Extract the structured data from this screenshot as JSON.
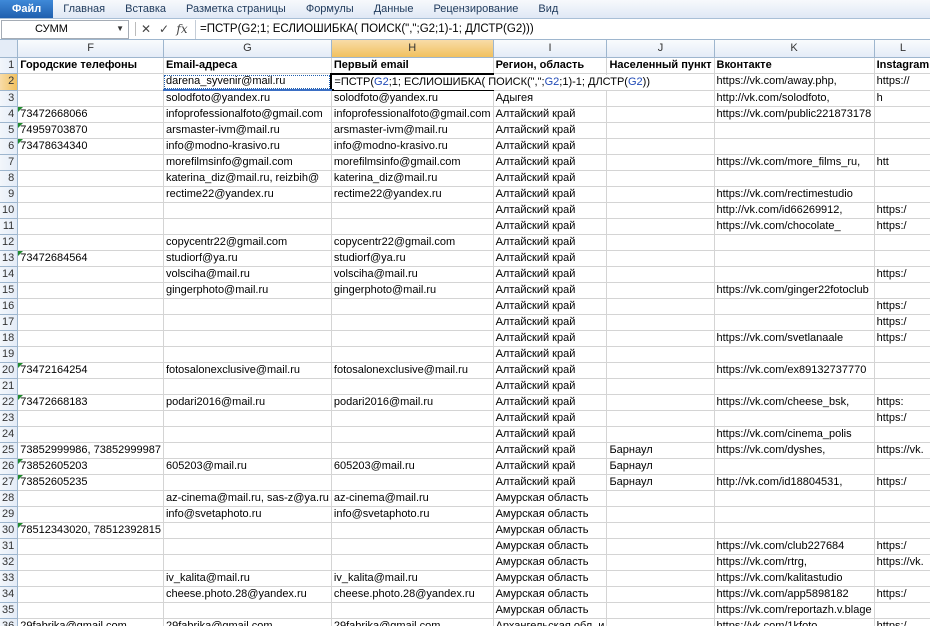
{
  "ribbon": {
    "tabs": [
      "Файл",
      "Главная",
      "Вставка",
      "Разметка страницы",
      "Формулы",
      "Данные",
      "Рецензирование",
      "Вид"
    ],
    "active_index": 0
  },
  "formula_bar": {
    "name_box": "СУММ",
    "cancel_glyph": "✕",
    "enter_glyph": "✓",
    "fx_label": "fx",
    "formula": "=ПСТР(G2;1; ЕСЛИОШИБКА( ПОИСК(\",\";G2;1)-1; ДЛСТР(G2)))"
  },
  "columns": [
    "F",
    "G",
    "H",
    "I",
    "J",
    "K",
    "L"
  ],
  "selected_column": "H",
  "active_cell_formula": {
    "p1": "=ПСТР(",
    "ref1": "G2",
    "p2": ";1; ЕСЛИОШИБКА( ПОИСК(\",\";",
    "ref2": "G2",
    "p3": ";1)-1; ДЛСТР(",
    "ref3": "G2",
    "p4": "))"
  },
  "rows": [
    {
      "n": "1",
      "F": "Городские телефоны",
      "G": "Email-адреса",
      "H": "Первый email",
      "I": "Регион, область",
      "J": "Населенный пункт",
      "K": "Вконтакте",
      "L": "Instagram"
    },
    {
      "n": "2",
      "F": "",
      "G": "darena_syvenir@mail.ru",
      "H": "",
      "I": "",
      "J": "",
      "K": "https://vk.com/away.php,",
      "L": "https://"
    },
    {
      "n": "3",
      "F": "",
      "G": "solodfoto@yandex.ru",
      "H": "solodfoto@yandex.ru",
      "I": "Адыгея",
      "J": "",
      "K": "http://vk.com/solodfoto,",
      "L": "h"
    },
    {
      "n": "4",
      "F": "73472668066",
      "G": "infoprofessionalfoto@gmail.com",
      "H": "infoprofessionalfoto@gmail.com",
      "I": "Алтайский край",
      "J": "",
      "K": "https://vk.com/public221873178",
      "L": ""
    },
    {
      "n": "5",
      "F": "74959703870",
      "G": "arsmaster-ivm@mail.ru",
      "H": "arsmaster-ivm@mail.ru",
      "I": "Алтайский край",
      "J": "",
      "K": "",
      "L": ""
    },
    {
      "n": "6",
      "F": "73478634340",
      "G": "info@modno-krasivo.ru",
      "H": "info@modno-krasivo.ru",
      "I": "Алтайский край",
      "J": "",
      "K": "",
      "L": ""
    },
    {
      "n": "7",
      "F": "",
      "G": "morefilmsinfo@gmail.com",
      "H": "morefilmsinfo@gmail.com",
      "I": "Алтайский край",
      "J": "",
      "K": "https://vk.com/more_films_ru,",
      "L": "htt"
    },
    {
      "n": "8",
      "F": "",
      "G": "katerina_diz@mail.ru, reizbih@",
      "H": "katerina_diz@mail.ru",
      "I": "Алтайский край",
      "J": "",
      "K": "",
      "L": ""
    },
    {
      "n": "9",
      "F": "",
      "G": "rectime22@yandex.ru",
      "H": "rectime22@yandex.ru",
      "I": "Алтайский край",
      "J": "",
      "K": "https://vk.com/rectimestudio",
      "L": ""
    },
    {
      "n": "10",
      "F": "",
      "G": "",
      "H": "",
      "I": "Алтайский край",
      "J": "",
      "K": "http://vk.com/id66269912,",
      "L": "https:/"
    },
    {
      "n": "11",
      "F": "",
      "G": "",
      "H": "",
      "I": "Алтайский край",
      "J": "",
      "K": "https://vk.com/chocolate_",
      "L": "https:/"
    },
    {
      "n": "12",
      "F": "",
      "G": "copycentr22@gmail.com",
      "H": "copycentr22@gmail.com",
      "I": "Алтайский край",
      "J": "",
      "K": "",
      "L": ""
    },
    {
      "n": "13",
      "F": "73472684564",
      "G": "studiorf@ya.ru",
      "H": "studiorf@ya.ru",
      "I": "Алтайский край",
      "J": "",
      "K": "",
      "L": ""
    },
    {
      "n": "14",
      "F": "",
      "G": "volsciha@mail.ru",
      "H": "volsciha@mail.ru",
      "I": "Алтайский край",
      "J": "",
      "K": "",
      "L": "https:/"
    },
    {
      "n": "15",
      "F": "",
      "G": "gingerphoto@mail.ru",
      "H": "gingerphoto@mail.ru",
      "I": "Алтайский край",
      "J": "",
      "K": "https://vk.com/ginger22fotoclub",
      "L": ""
    },
    {
      "n": "16",
      "F": "",
      "G": "",
      "H": "",
      "I": "Алтайский край",
      "J": "",
      "K": "",
      "L": "https:/"
    },
    {
      "n": "17",
      "F": "",
      "G": "",
      "H": "",
      "I": "Алтайский край",
      "J": "",
      "K": "",
      "L": "https:/"
    },
    {
      "n": "18",
      "F": "",
      "G": "",
      "H": "",
      "I": "Алтайский край",
      "J": "",
      "K": "https://vk.com/svetlanaale",
      "L": "https:/"
    },
    {
      "n": "19",
      "F": "",
      "G": "",
      "H": "",
      "I": "Алтайский край",
      "J": "",
      "K": "",
      "L": ""
    },
    {
      "n": "20",
      "F": "73472164254",
      "G": "fotosalonexclusive@mail.ru",
      "H": "fotosalonexclusive@mail.ru",
      "I": "Алтайский край",
      "J": "",
      "K": "https://vk.com/ex89132737770",
      "L": ""
    },
    {
      "n": "21",
      "F": "",
      "G": "",
      "H": "",
      "I": "Алтайский край",
      "J": "",
      "K": "",
      "L": ""
    },
    {
      "n": "22",
      "F": "73472668183",
      "G": "podari2016@mail.ru",
      "H": "podari2016@mail.ru",
      "I": "Алтайский край",
      "J": "",
      "K": "https://vk.com/cheese_bsk,",
      "L": "https:"
    },
    {
      "n": "23",
      "F": "",
      "G": "",
      "H": "",
      "I": "Алтайский край",
      "J": "",
      "K": "",
      "L": "https:/"
    },
    {
      "n": "24",
      "F": "",
      "G": "",
      "H": "",
      "I": "Алтайский край",
      "J": "",
      "K": "https://vk.com/cinema_polis",
      "L": ""
    },
    {
      "n": "25",
      "F": "73852999986, 73852999987",
      "G": "",
      "H": "",
      "I": "Алтайский край",
      "J": "Барнаул",
      "K": "https://vk.com/dyshes,",
      "L": "https://vk."
    },
    {
      "n": "26",
      "F": "73852605203",
      "G": "605203@mail.ru",
      "H": "605203@mail.ru",
      "I": "Алтайский край",
      "J": "Барнаул",
      "K": "",
      "L": ""
    },
    {
      "n": "27",
      "F": "73852605235",
      "G": "",
      "H": "",
      "I": "Алтайский край",
      "J": "Барнаул",
      "K": "http://vk.com/id18804531,",
      "L": "https:/"
    },
    {
      "n": "28",
      "F": "",
      "G": "az-cinema@mail.ru, sas-z@ya.ru",
      "H": "az-cinema@mail.ru",
      "I": "Амурская область",
      "J": "",
      "K": "",
      "L": ""
    },
    {
      "n": "29",
      "F": "",
      "G": "info@svetaphoto.ru",
      "H": "info@svetaphoto.ru",
      "I": "Амурская область",
      "J": "",
      "K": "",
      "L": ""
    },
    {
      "n": "30",
      "F": "78512343020, 78512392815",
      "G": "",
      "H": "",
      "I": "Амурская область",
      "J": "",
      "K": "",
      "L": ""
    },
    {
      "n": "31",
      "F": "",
      "G": "",
      "H": "",
      "I": "Амурская область",
      "J": "",
      "K": "https://vk.com/club227684",
      "L": "https:/"
    },
    {
      "n": "32",
      "F": "",
      "G": "",
      "H": "",
      "I": "Амурская область",
      "J": "",
      "K": "https://vk.com/rtrg,",
      "L": "https://vk."
    },
    {
      "n": "33",
      "F": "",
      "G": "iv_kalita@mail.ru",
      "H": "iv_kalita@mail.ru",
      "I": "Амурская область",
      "J": "",
      "K": "https://vk.com/kalitastudio",
      "L": ""
    },
    {
      "n": "34",
      "F": "",
      "G": "cheese.photo.28@yandex.ru",
      "H": "cheese.photo.28@yandex.ru",
      "I": "Амурская область",
      "J": "",
      "K": "https://vk.com/app5898182",
      "L": "https:/"
    },
    {
      "n": "35",
      "F": "",
      "G": "",
      "H": "",
      "I": "Амурская область",
      "J": "",
      "K": "https://vk.com/reportazh.v.blage",
      "L": ""
    },
    {
      "n": "36",
      "F": "29fabrika@gmail.com",
      "G": "29fabrika@gmail.com",
      "H": "29fabrika@gmail.com",
      "I": "Архангельская обл. и",
      "J": "",
      "K": "https://vk.com/1kfoto,",
      "L": "https:/"
    }
  ],
  "green_marker_rows": [
    "4",
    "5",
    "6",
    "13",
    "20",
    "22",
    "26",
    "27",
    "30"
  ]
}
